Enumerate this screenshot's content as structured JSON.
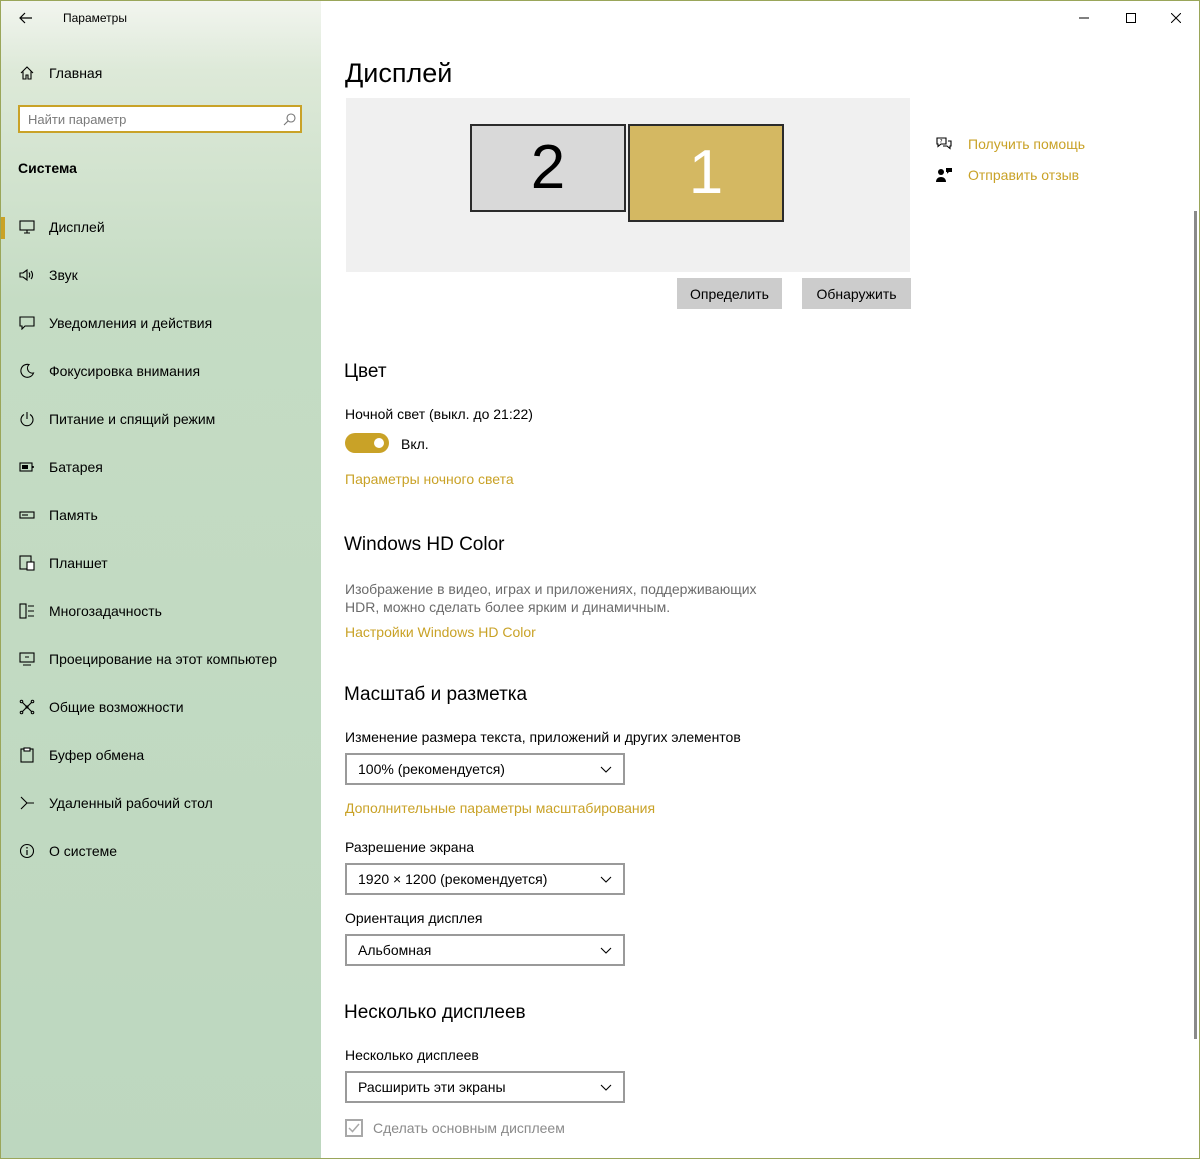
{
  "window": {
    "title": "Параметры"
  },
  "sidebar": {
    "home": "Главная",
    "search_placeholder": "Найти параметр",
    "section": "Система",
    "items": [
      "Дисплей",
      "Звук",
      "Уведомления и действия",
      "Фокусировка внимания",
      "Питание и спящий режим",
      "Батарея",
      "Память",
      "Планшет",
      "Многозадачность",
      "Проецирование на этот компьютер",
      "Общие возможности",
      "Буфер обмена",
      "Удаленный рабочий стол",
      "О системе"
    ],
    "active_index": 0
  },
  "main": {
    "title": "Дисплей",
    "monitors": [
      "1",
      "2"
    ],
    "identify_button": "Определить",
    "detect_button": "Обнаружить",
    "color": {
      "title": "Цвет",
      "night_light_label": "Ночной свет (выкл. до 21:22)",
      "toggle_state": "Вкл.",
      "night_light_link": "Параметры ночного света"
    },
    "hd_color": {
      "title": "Windows HD Color",
      "description_line1": "Изображение в видео, играх и приложениях, поддерживающих",
      "description_line2": "HDR, можно сделать более ярким и динамичным.",
      "link": "Настройки Windows HD Color"
    },
    "scale": {
      "title": "Масштаб и разметка",
      "size_label": "Изменение размера текста, приложений и других элементов",
      "size_value": "100% (рекомендуется)",
      "advanced_link": "Дополнительные параметры масштабирования",
      "resolution_label": "Разрешение экрана",
      "resolution_value": "1920 × 1200 (рекомендуется)",
      "orientation_label": "Ориентация дисплея",
      "orientation_value": "Альбомная"
    },
    "multiple": {
      "title": "Несколько дисплеев",
      "label": "Несколько дисплеев",
      "value": "Расширить эти экраны",
      "make_main_label": "Сделать основным дисплеем",
      "make_main_checked": true
    }
  },
  "help": {
    "get_help": "Получить помощь",
    "send_feedback": "Отправить отзыв"
  },
  "colors": {
    "accent": "#c9a227",
    "monitor_active": "#d4b862",
    "monitor_inactive": "#d9d9d9",
    "sidebar_bg": "#c5dcc4"
  }
}
